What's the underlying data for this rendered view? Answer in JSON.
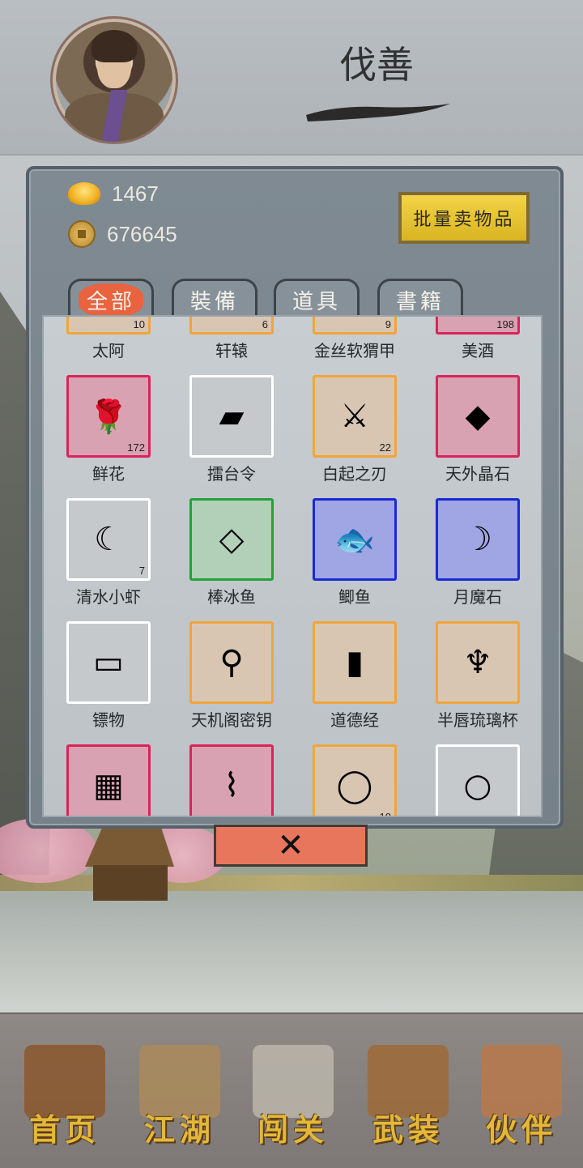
{
  "player": {
    "name": "伐善",
    "avatar_icon": "character-portrait"
  },
  "currency": {
    "gold": {
      "icon": "gold-ingot-icon",
      "value": "1467"
    },
    "coins": {
      "icon": "copper-coin-icon",
      "value": "676645"
    }
  },
  "sell_button_label": "批量卖物品",
  "tabs": [
    {
      "label": "全部",
      "active": true
    },
    {
      "label": "裝備",
      "active": false
    },
    {
      "label": "道具",
      "active": false
    },
    {
      "label": "書籍",
      "active": false
    }
  ],
  "items": [
    {
      "name": "太阿",
      "count": "10",
      "rarity": "orange",
      "icon": "sword-icon"
    },
    {
      "name": "轩辕",
      "count": "6",
      "rarity": "orange",
      "icon": "sword-icon"
    },
    {
      "name": "金丝软猬甲",
      "count": "9",
      "rarity": "orange",
      "icon": "armor-icon"
    },
    {
      "name": "美酒",
      "count": "198",
      "rarity": "pink",
      "icon": "wine-icon"
    },
    {
      "name": "鲜花",
      "count": "172",
      "rarity": "pink",
      "icon": "rose-icon"
    },
    {
      "name": "擂台令",
      "count": "",
      "rarity": "white",
      "icon": "token-icon"
    },
    {
      "name": "白起之刃",
      "count": "22",
      "rarity": "orange",
      "icon": "blade-icon"
    },
    {
      "name": "天外晶石",
      "count": "",
      "rarity": "pink",
      "icon": "crystal-icon"
    },
    {
      "name": "清水小虾",
      "count": "7",
      "rarity": "white",
      "icon": "shrimp-icon"
    },
    {
      "name": "棒冰鱼",
      "count": "",
      "rarity": "green",
      "icon": "small-fish-icon"
    },
    {
      "name": "鲫鱼",
      "count": "",
      "rarity": "blue",
      "icon": "fish-icon"
    },
    {
      "name": "月魔石",
      "count": "",
      "rarity": "blue",
      "icon": "moon-stone-icon"
    },
    {
      "name": "镖物",
      "count": "",
      "rarity": "white",
      "icon": "cargo-box-icon"
    },
    {
      "name": "天机阁密钥",
      "count": "",
      "rarity": "orange",
      "icon": "key-instrument-icon"
    },
    {
      "name": "道德经",
      "count": "",
      "rarity": "orange",
      "icon": "book-icon"
    },
    {
      "name": "半唇琉璃杯",
      "count": "",
      "rarity": "orange",
      "icon": "glass-cup-icon"
    },
    {
      "name": "",
      "count": "",
      "rarity": "pink",
      "icon": "gold-tray-icon"
    },
    {
      "name": "",
      "count": "",
      "rarity": "pink",
      "icon": "necklace-icon"
    },
    {
      "name": "",
      "count": "10",
      "rarity": "orange",
      "icon": "ring-icon"
    },
    {
      "name": "",
      "count": "",
      "rarity": "white",
      "icon": "bracelet-icon"
    }
  ],
  "close_button": {
    "label": "✕",
    "icon": "close-icon"
  },
  "nav": [
    {
      "label": "首页",
      "icon": "home-pavilion-icon"
    },
    {
      "label": "江湖",
      "icon": "scroll-icon"
    },
    {
      "label": "闯关",
      "icon": "crossed-swords-icon"
    },
    {
      "label": "武装",
      "icon": "armor-icon"
    },
    {
      "label": "伙伴",
      "icon": "companions-icon"
    }
  ],
  "colors": {
    "rarity_pink": "#d9245a",
    "rarity_orange": "#f0a53c",
    "rarity_white": "#ffffff",
    "rarity_green": "#23a23a",
    "rarity_blue": "#1a2ad6",
    "sell_button": "#f2d447",
    "active_tab": "#e9633f",
    "close_button": "#e8765c",
    "nav_label": "#e3b83a"
  }
}
